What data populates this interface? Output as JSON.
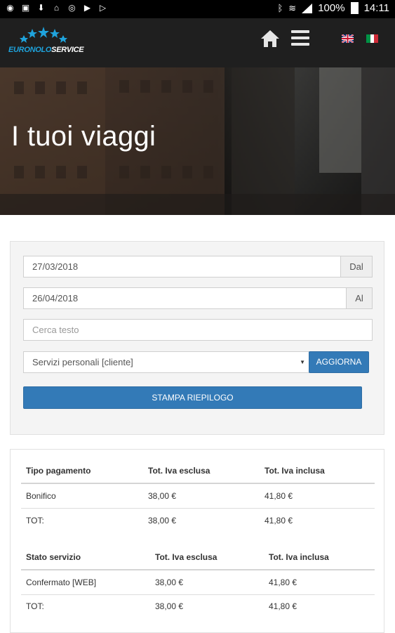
{
  "status_bar": {
    "left_icons": [
      "notification-icon",
      "image-icon",
      "download-icon",
      "home-icon",
      "sync-icon",
      "play-icon",
      "play-store-icon"
    ],
    "battery": "100%",
    "time": "14:11"
  },
  "header": {
    "logo_text_part1": "EURONOLO",
    "logo_text_part2": "SERVICE",
    "languages": [
      "en",
      "it"
    ]
  },
  "hero": {
    "title": "I tuoi viaggi"
  },
  "filters": {
    "date_from": "27/03/2018",
    "date_from_addon": "Dal",
    "date_to": "26/04/2018",
    "date_to_addon": "Al",
    "search_placeholder": "Cerca testo",
    "service_select": "Servizi personali [cliente]",
    "refresh_button": "AGGIORNA",
    "print_button": "STAMPA RIEPILOGO"
  },
  "payment_table": {
    "headers": [
      "Tipo pagamento",
      "Tot. Iva esclusa",
      "Tot. Iva inclusa"
    ],
    "rows": [
      [
        "Bonifico",
        "38,00 €",
        "41,80 €"
      ],
      [
        "TOT:",
        "38,00 €",
        "41,80 €"
      ]
    ]
  },
  "status_table": {
    "headers": [
      "Stato servizio",
      "Tot. Iva esclusa",
      "Tot. Iva inclusa"
    ],
    "rows": [
      [
        "Confermato [WEB]",
        "38,00 €",
        "41,80 €"
      ],
      [
        "TOT:",
        "38,00 €",
        "41,80 €"
      ]
    ]
  },
  "colors": {
    "primary_button": "#337ab7",
    "topbar": "#1f1f1f",
    "logo_accent": "#1fa3dc"
  }
}
